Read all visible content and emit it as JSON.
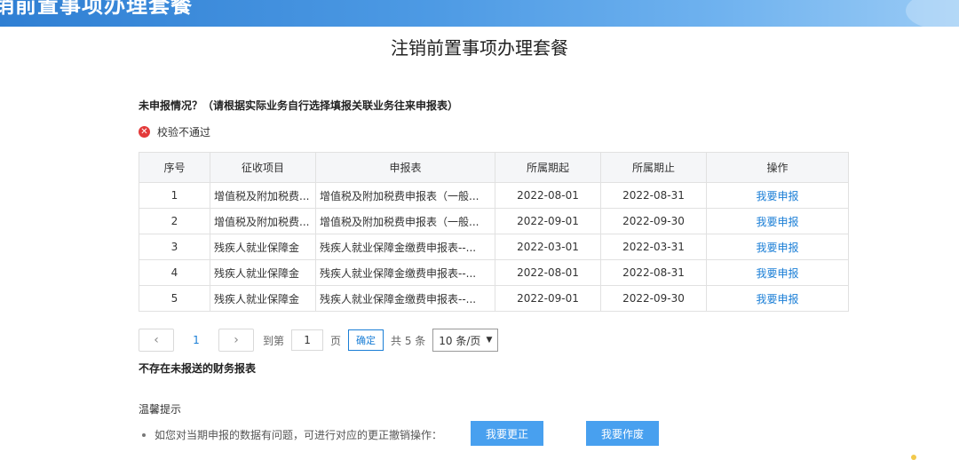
{
  "banner": {
    "title": "销前置事项办理套餐"
  },
  "page": {
    "title": "注销前置事项办理套餐"
  },
  "unreported": {
    "title": "未申报情况？（请根据实际业务自行选择填报关联业务往来申报表）",
    "verify_status": "校验不通过",
    "columns": [
      "序号",
      "征收项目",
      "申报表",
      "所属期起",
      "所属期止",
      "操作"
    ],
    "rows": [
      [
        "1",
        "增值税及附加税费...",
        "增值税及附加税费申报表（一般...",
        "2022-08-01",
        "2022-08-31",
        "我要申报"
      ],
      [
        "2",
        "增值税及附加税费...",
        "增值税及附加税费申报表（一般...",
        "2022-09-01",
        "2022-09-30",
        "我要申报"
      ],
      [
        "3",
        "残疾人就业保障金",
        "残疾人就业保障金缴费申报表--...",
        "2022-03-01",
        "2022-03-31",
        "我要申报"
      ],
      [
        "4",
        "残疾人就业保障金",
        "残疾人就业保障金缴费申报表--...",
        "2022-08-01",
        "2022-08-31",
        "我要申报"
      ],
      [
        "5",
        "残疾人就业保障金",
        "残疾人就业保障金缴费申报表--...",
        "2022-09-01",
        "2022-09-30",
        "我要申报"
      ]
    ]
  },
  "pager": {
    "prev": "‹",
    "next": "›",
    "current": "1",
    "goto_label": "到第",
    "goto_value": "1",
    "page_unit": "页",
    "confirm": "确定",
    "total": "共 5 条",
    "page_size": "10 条/页",
    "size_arrow": "▼"
  },
  "financial": {
    "text": "不存在未报送的财务报表"
  },
  "tips": {
    "title": "温馨提示",
    "line": "如您对当期申报的数据有问题，可进行对应的更正撤销操作：",
    "correct_button": "我要更正",
    "void_button": "我要作废"
  },
  "colors": {
    "accent": "#1a7ed6",
    "button": "#48a0ef",
    "error": "#e33a3a"
  },
  "icons": {
    "verify": "error-circle-icon"
  }
}
